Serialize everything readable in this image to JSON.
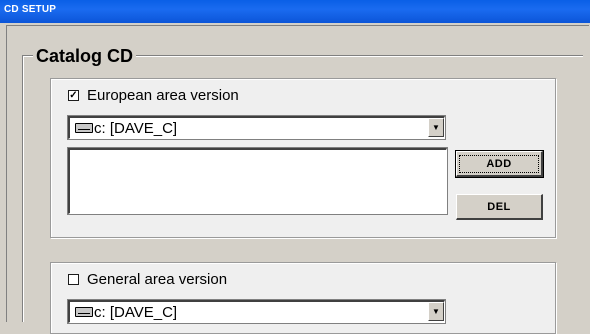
{
  "window": {
    "title": "CD SETUP"
  },
  "catalog": {
    "label": "Catalog  CD"
  },
  "european": {
    "checkbox_label": "European area version",
    "checked_mark": "✓",
    "drive_value": "c: [DAVE_C]",
    "add_label": "ADD",
    "del_label": "DEL"
  },
  "general": {
    "checkbox_label": "General area version",
    "drive_value": "c: [DAVE_C]"
  },
  "icons": {
    "drive": "drive-icon",
    "dropdown": "chevron-down-icon"
  }
}
